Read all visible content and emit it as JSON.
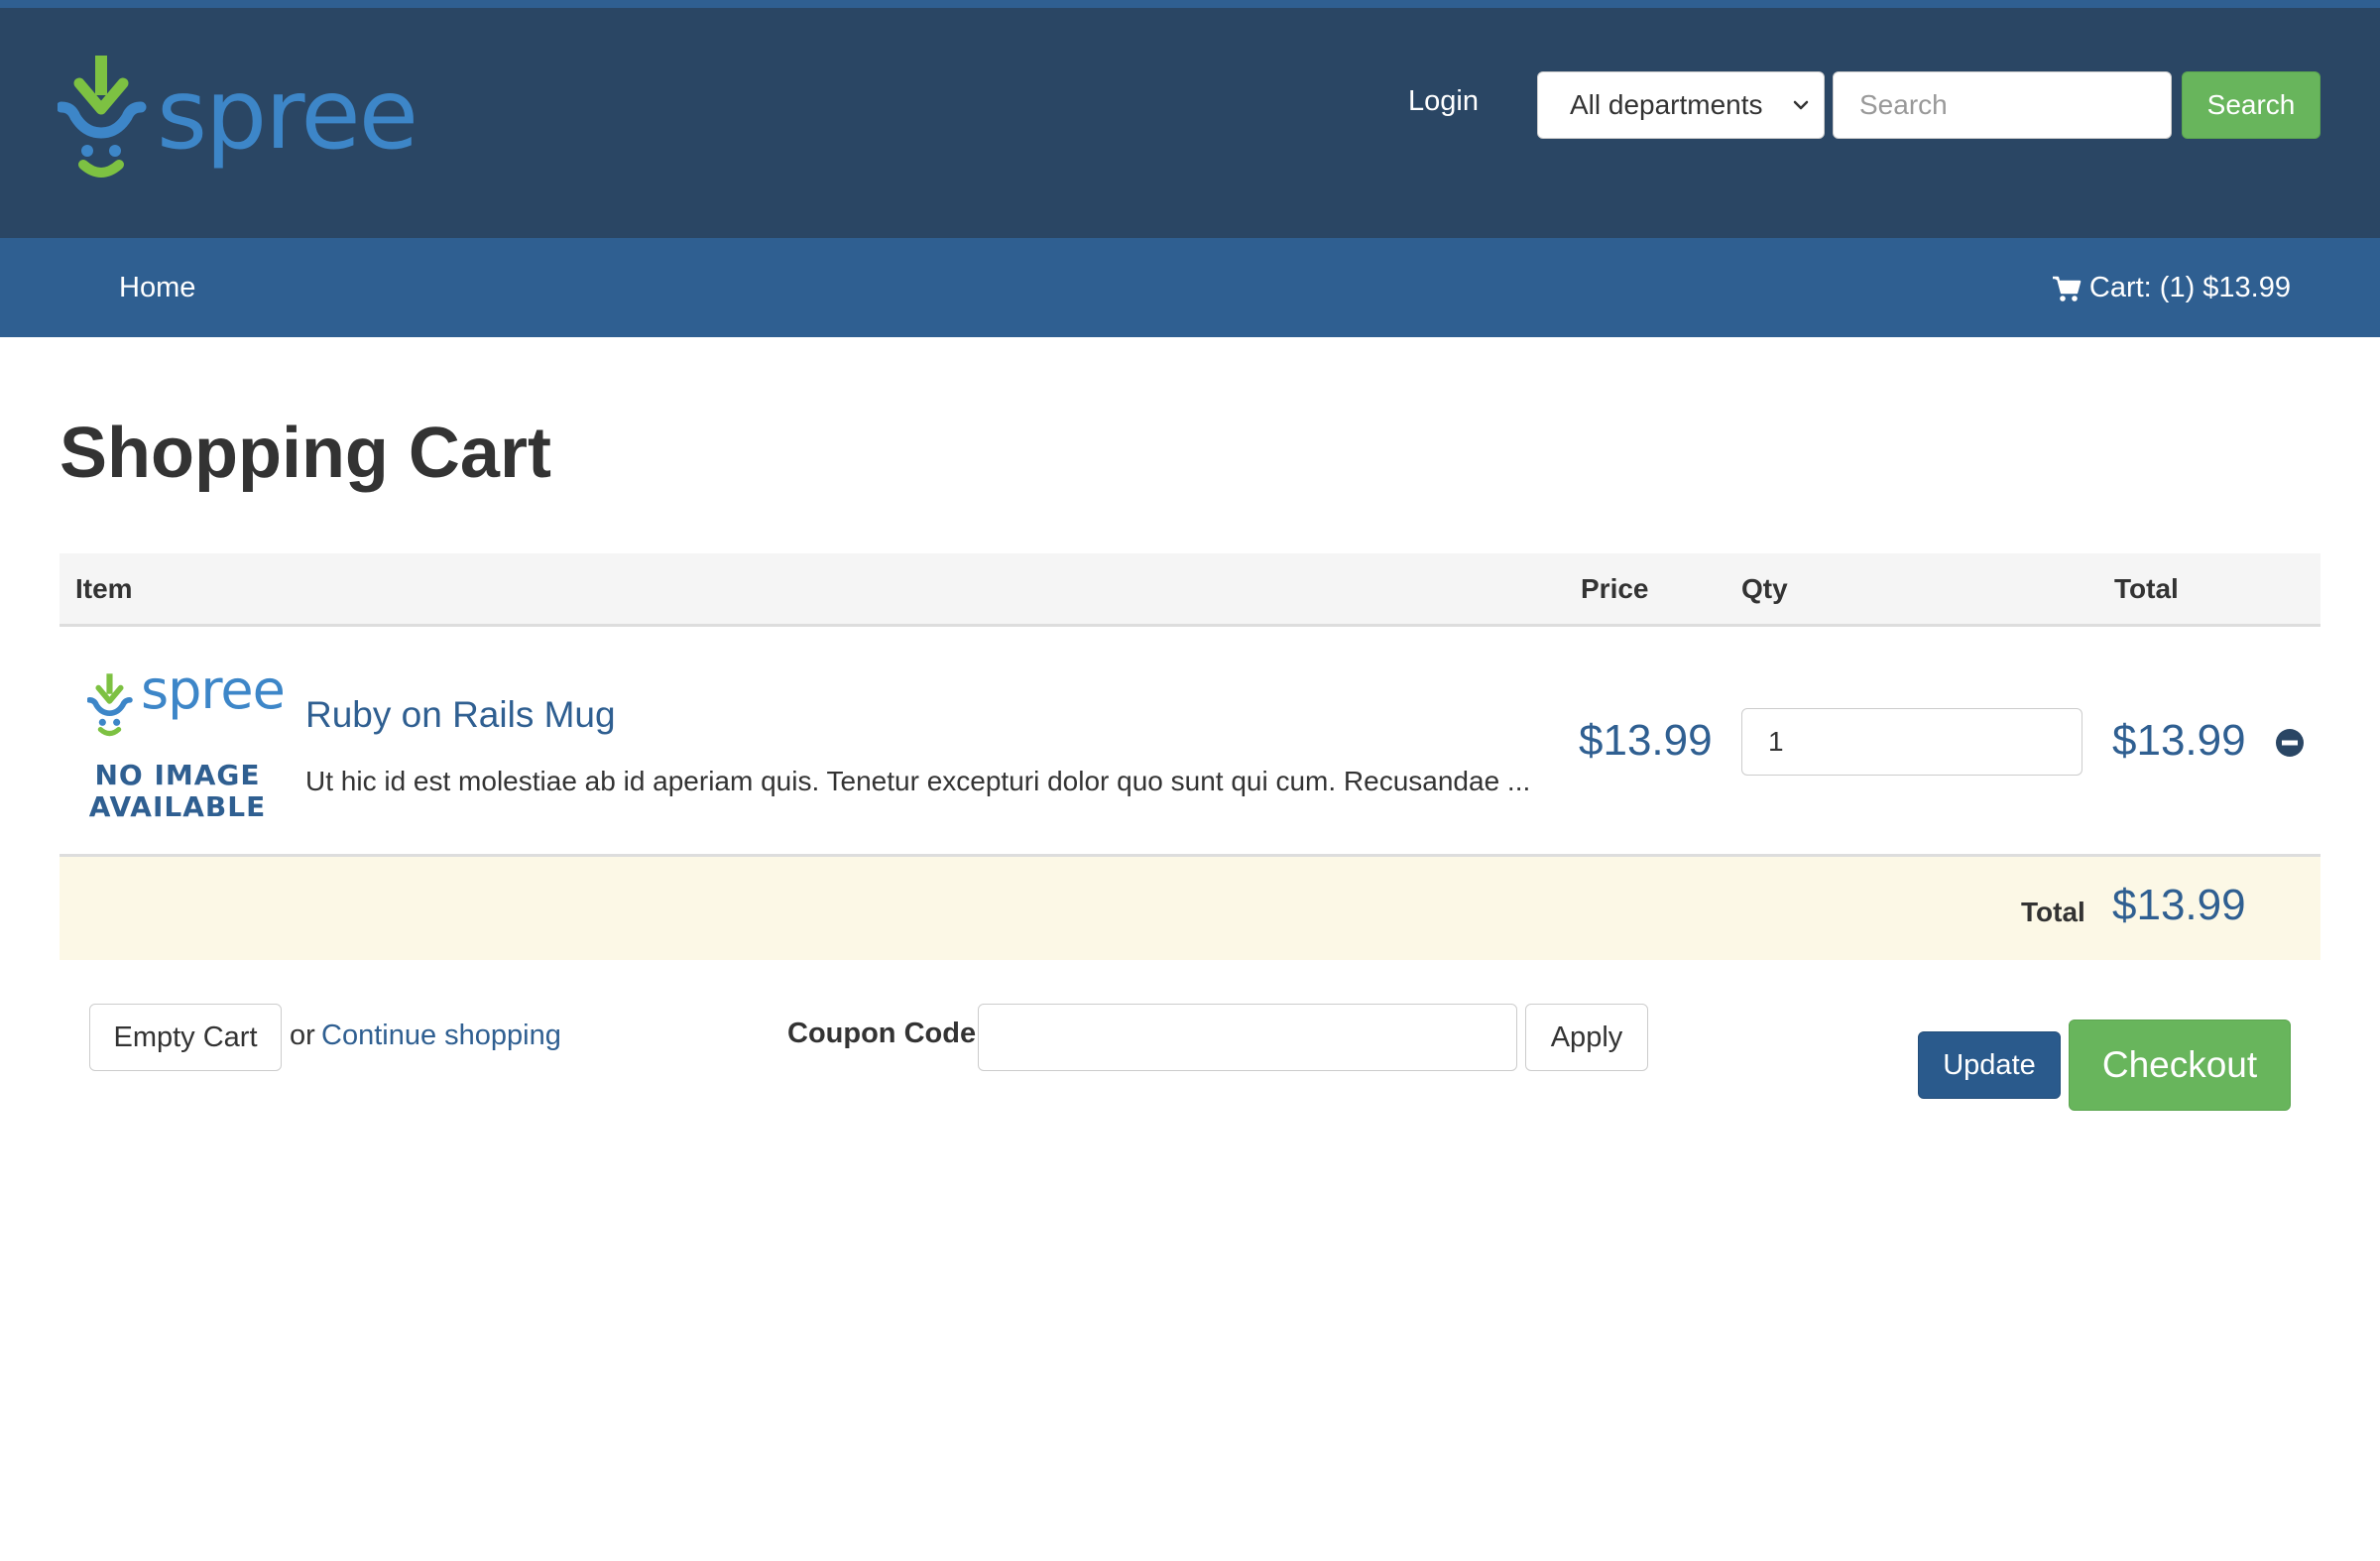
{
  "header": {
    "logo_text": "spree",
    "login_label": "Login",
    "department_selected": "All departments",
    "search_placeholder": "Search",
    "search_button": "Search"
  },
  "nav": {
    "home_label": "Home",
    "cart_label": "Cart: (1) $13.99"
  },
  "page": {
    "title": "Shopping Cart"
  },
  "table": {
    "headers": {
      "item": "Item",
      "price": "Price",
      "qty": "Qty",
      "total": "Total"
    },
    "rows": [
      {
        "thumb_logo_text": "spree",
        "thumb_no_image_line1": "NO IMAGE",
        "thumb_no_image_line2": "AVAILABLE",
        "name": "Ruby on Rails Mug",
        "description": "Ut hic id est molestiae ab id aperiam quis. Tenetur excepturi dolor quo sunt qui cum. Recusandae ...",
        "price": "$13.99",
        "qty": "1",
        "total": "$13.99"
      }
    ],
    "total_label": "Total",
    "total_value": "$13.99"
  },
  "actions": {
    "empty_cart": "Empty Cart",
    "or_text": "or",
    "continue_shopping": "Continue shopping",
    "coupon_label": "Coupon Code",
    "coupon_value": "",
    "apply": "Apply",
    "update": "Update",
    "checkout": "Checkout"
  },
  "colors": {
    "header_bg": "#2a4664",
    "nav_bg": "#2f5f91",
    "brand_blue": "#3d86c8",
    "brand_green": "#7dc142",
    "success_green": "#68b55c",
    "total_row_bg": "#fcf8e6"
  },
  "icons": {
    "logo": "spree-logo-icon",
    "cart": "shopping-cart-icon",
    "remove": "minus-circle-icon",
    "dropdown": "chevron-down-icon"
  }
}
